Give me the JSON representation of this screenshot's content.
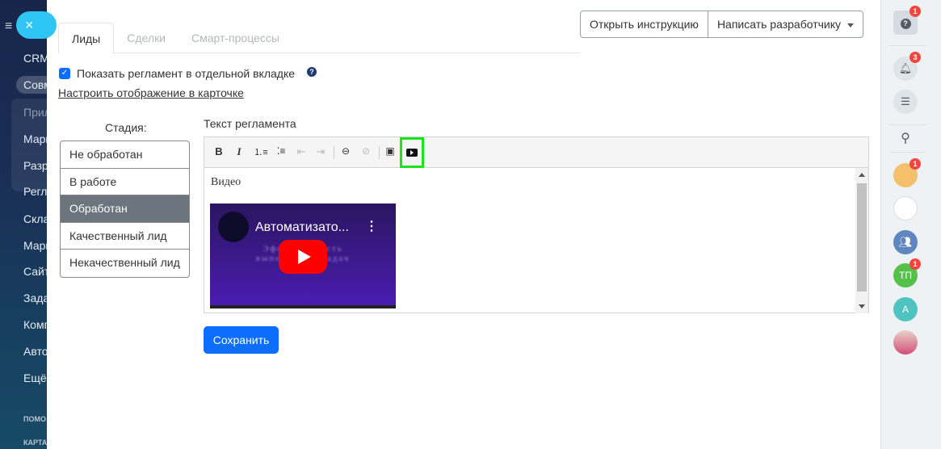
{
  "leftnav": {
    "items": [
      "CRM",
      "Совм",
      "Прил",
      "Марк",
      "Разр",
      "Регл",
      "Скла",
      "Марк",
      "Сайт",
      "Зада",
      "Комп",
      "Авто",
      "Ещё"
    ],
    "small": [
      "ПОМО",
      "КАРТА"
    ],
    "close_icon": "×",
    "menu_icon": "≡"
  },
  "tabs": [
    "Лиды",
    "Сделки",
    "Смарт-процессы"
  ],
  "top_buttons": {
    "instruction": "Открыть инструкцию",
    "developer": "Написать разработчику"
  },
  "checkbox": {
    "label": "Показать регламент в отдельной вкладке",
    "checked": true,
    "help": "?"
  },
  "configure_link": "Настроить отображение в карточке",
  "stages": {
    "label": "Стадия:",
    "items": [
      "Не обработан",
      "В работе",
      "Обработан",
      "Качественный лид",
      "Некачественный лид"
    ],
    "selected": "Обработан"
  },
  "editor": {
    "label": "Текст регламента",
    "toolbar": {
      "bold": "B",
      "italic": "I"
    },
    "content_text": "Видео",
    "video": {
      "title": "Автоматизато...",
      "overlay_text": "Эффективность выполнения задач"
    }
  },
  "save_label": "Сохранить",
  "rightbar": {
    "help": "?",
    "help_badge": "1",
    "notif_badge": "3",
    "chat3_badge": "1",
    "chat4_initials": "ТП",
    "chat4_badge": "1",
    "chat5_initials": "А"
  },
  "colors": {
    "accent": "#0d6efd",
    "highlight": "#1de31d",
    "selected_stage": "#6c757d"
  }
}
